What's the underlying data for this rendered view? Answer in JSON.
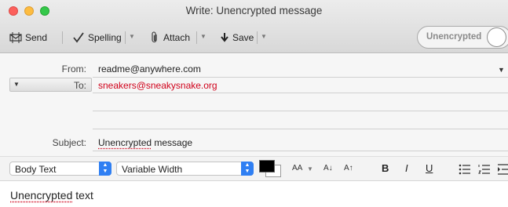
{
  "window": {
    "title": "Write: Unencrypted message"
  },
  "toolbar": {
    "send_label": "Send",
    "spelling_label": "Spelling",
    "attach_label": "Attach",
    "save_label": "Save",
    "encryption_toggle_label": "Unencrypted",
    "encryption_enabled": false
  },
  "headers": {
    "from_label": "From:",
    "from_value": "readme@anywhere.com",
    "to_label": "To:",
    "to_value": "sneakers@sneakysnake.org",
    "subject_label": "Subject:",
    "subject_misspelled": "Unencrypted",
    "subject_rest": " message"
  },
  "format": {
    "paragraph_style": "Body Text",
    "font": "Variable Width",
    "text_color": "#000000",
    "font_size_label": "AA",
    "shrink_label": "A",
    "grow_label": "A",
    "bold_label": "B",
    "italic_label": "I",
    "underline_label": "U"
  },
  "body": {
    "misspelled_word": "Unencrypted",
    "rest": " text"
  },
  "colors": {
    "accent": "#2f7ff3",
    "error_underline": "#d0021b",
    "recipient_text": "#d0021b"
  }
}
